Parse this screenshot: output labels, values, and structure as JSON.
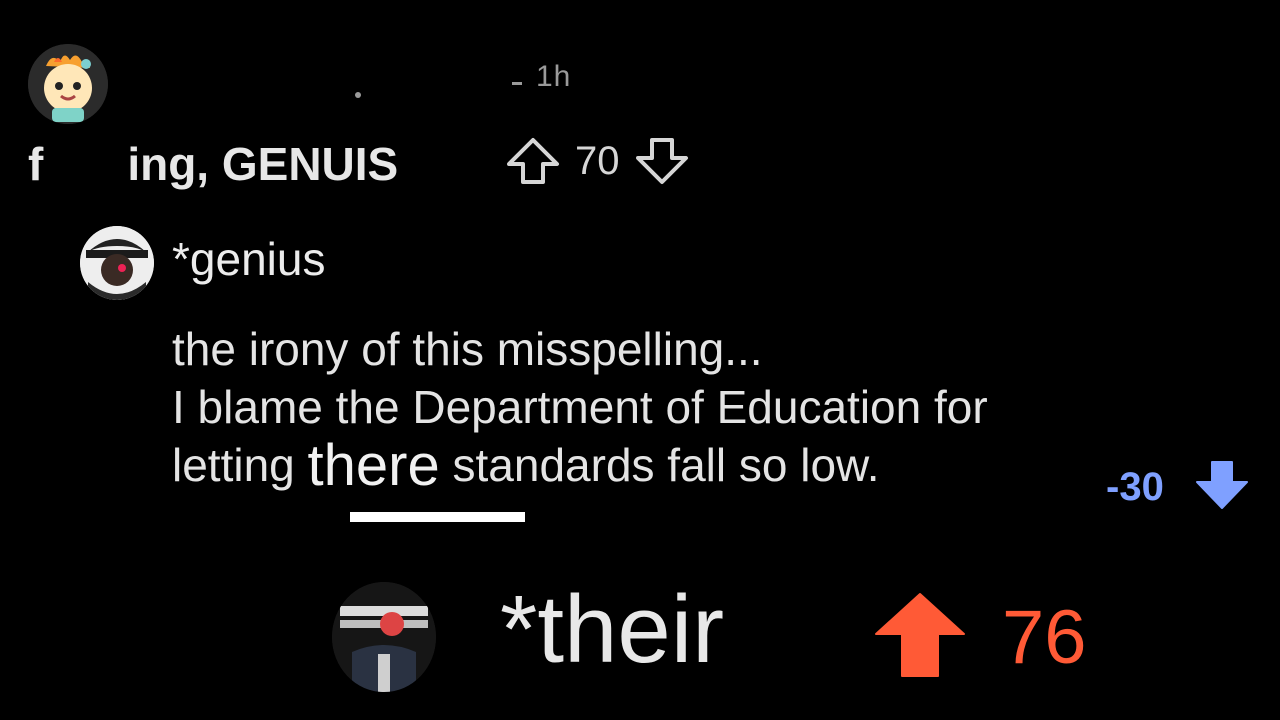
{
  "top_comment": {
    "time_ago": "1h",
    "text_prefix": "f",
    "text_suffix": "ing, GENUIS",
    "score": "70"
  },
  "reply": {
    "title": "*genius",
    "line1": "the irony of this misspelling...",
    "line2": "I blame the Department of Education for",
    "line3_before": "letting ",
    "line3_highlight": "there",
    "line3_after": " standards fall so low.",
    "score": "-30"
  },
  "bottom_reply": {
    "text": "*their",
    "score": "76"
  },
  "colors": {
    "background": "#000000",
    "downvote_active": "#7fa0ff",
    "upvote_active": "#ff5a36",
    "neutral_vote": "#d6d6d6"
  },
  "icons": {
    "upvote": "arrow-up-icon",
    "downvote": "arrow-down-icon"
  }
}
